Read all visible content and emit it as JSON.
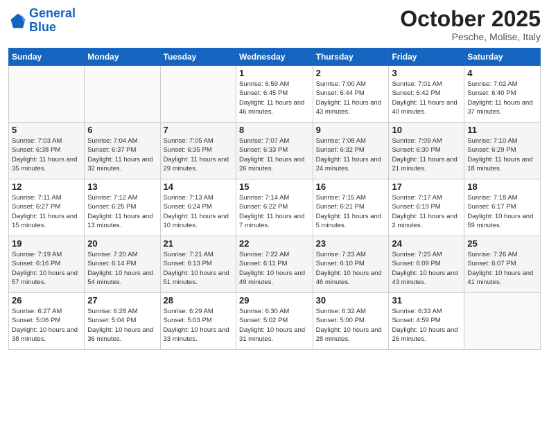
{
  "header": {
    "logo": {
      "line1": "General",
      "line2": "Blue"
    },
    "title": "October 2025",
    "subtitle": "Pesche, Molise, Italy"
  },
  "weekdays": [
    "Sunday",
    "Monday",
    "Tuesday",
    "Wednesday",
    "Thursday",
    "Friday",
    "Saturday"
  ],
  "weeks": [
    [
      {
        "day": "",
        "sunrise": "",
        "sunset": "",
        "daylight": ""
      },
      {
        "day": "",
        "sunrise": "",
        "sunset": "",
        "daylight": ""
      },
      {
        "day": "",
        "sunrise": "",
        "sunset": "",
        "daylight": ""
      },
      {
        "day": "1",
        "sunrise": "Sunrise: 6:59 AM",
        "sunset": "Sunset: 6:45 PM",
        "daylight": "Daylight: 11 hours and 46 minutes."
      },
      {
        "day": "2",
        "sunrise": "Sunrise: 7:00 AM",
        "sunset": "Sunset: 6:44 PM",
        "daylight": "Daylight: 11 hours and 43 minutes."
      },
      {
        "day": "3",
        "sunrise": "Sunrise: 7:01 AM",
        "sunset": "Sunset: 6:42 PM",
        "daylight": "Daylight: 11 hours and 40 minutes."
      },
      {
        "day": "4",
        "sunrise": "Sunrise: 7:02 AM",
        "sunset": "Sunset: 6:40 PM",
        "daylight": "Daylight: 11 hours and 37 minutes."
      }
    ],
    [
      {
        "day": "5",
        "sunrise": "Sunrise: 7:03 AM",
        "sunset": "Sunset: 6:38 PM",
        "daylight": "Daylight: 11 hours and 35 minutes."
      },
      {
        "day": "6",
        "sunrise": "Sunrise: 7:04 AM",
        "sunset": "Sunset: 6:37 PM",
        "daylight": "Daylight: 11 hours and 32 minutes."
      },
      {
        "day": "7",
        "sunrise": "Sunrise: 7:05 AM",
        "sunset": "Sunset: 6:35 PM",
        "daylight": "Daylight: 11 hours and 29 minutes."
      },
      {
        "day": "8",
        "sunrise": "Sunrise: 7:07 AM",
        "sunset": "Sunset: 6:33 PM",
        "daylight": "Daylight: 11 hours and 26 minutes."
      },
      {
        "day": "9",
        "sunrise": "Sunrise: 7:08 AM",
        "sunset": "Sunset: 6:32 PM",
        "daylight": "Daylight: 11 hours and 24 minutes."
      },
      {
        "day": "10",
        "sunrise": "Sunrise: 7:09 AM",
        "sunset": "Sunset: 6:30 PM",
        "daylight": "Daylight: 11 hours and 21 minutes."
      },
      {
        "day": "11",
        "sunrise": "Sunrise: 7:10 AM",
        "sunset": "Sunset: 6:29 PM",
        "daylight": "Daylight: 11 hours and 18 minutes."
      }
    ],
    [
      {
        "day": "12",
        "sunrise": "Sunrise: 7:11 AM",
        "sunset": "Sunset: 6:27 PM",
        "daylight": "Daylight: 11 hours and 15 minutes."
      },
      {
        "day": "13",
        "sunrise": "Sunrise: 7:12 AM",
        "sunset": "Sunset: 6:25 PM",
        "daylight": "Daylight: 11 hours and 13 minutes."
      },
      {
        "day": "14",
        "sunrise": "Sunrise: 7:13 AM",
        "sunset": "Sunset: 6:24 PM",
        "daylight": "Daylight: 11 hours and 10 minutes."
      },
      {
        "day": "15",
        "sunrise": "Sunrise: 7:14 AM",
        "sunset": "Sunset: 6:22 PM",
        "daylight": "Daylight: 11 hours and 7 minutes."
      },
      {
        "day": "16",
        "sunrise": "Sunrise: 7:15 AM",
        "sunset": "Sunset: 6:21 PM",
        "daylight": "Daylight: 11 hours and 5 minutes."
      },
      {
        "day": "17",
        "sunrise": "Sunrise: 7:17 AM",
        "sunset": "Sunset: 6:19 PM",
        "daylight": "Daylight: 11 hours and 2 minutes."
      },
      {
        "day": "18",
        "sunrise": "Sunrise: 7:18 AM",
        "sunset": "Sunset: 6:17 PM",
        "daylight": "Daylight: 10 hours and 59 minutes."
      }
    ],
    [
      {
        "day": "19",
        "sunrise": "Sunrise: 7:19 AM",
        "sunset": "Sunset: 6:16 PM",
        "daylight": "Daylight: 10 hours and 57 minutes."
      },
      {
        "day": "20",
        "sunrise": "Sunrise: 7:20 AM",
        "sunset": "Sunset: 6:14 PM",
        "daylight": "Daylight: 10 hours and 54 minutes."
      },
      {
        "day": "21",
        "sunrise": "Sunrise: 7:21 AM",
        "sunset": "Sunset: 6:13 PM",
        "daylight": "Daylight: 10 hours and 51 minutes."
      },
      {
        "day": "22",
        "sunrise": "Sunrise: 7:22 AM",
        "sunset": "Sunset: 6:11 PM",
        "daylight": "Daylight: 10 hours and 49 minutes."
      },
      {
        "day": "23",
        "sunrise": "Sunrise: 7:23 AM",
        "sunset": "Sunset: 6:10 PM",
        "daylight": "Daylight: 10 hours and 46 minutes."
      },
      {
        "day": "24",
        "sunrise": "Sunrise: 7:25 AM",
        "sunset": "Sunset: 6:09 PM",
        "daylight": "Daylight: 10 hours and 43 minutes."
      },
      {
        "day": "25",
        "sunrise": "Sunrise: 7:26 AM",
        "sunset": "Sunset: 6:07 PM",
        "daylight": "Daylight: 10 hours and 41 minutes."
      }
    ],
    [
      {
        "day": "26",
        "sunrise": "Sunrise: 6:27 AM",
        "sunset": "Sunset: 5:06 PM",
        "daylight": "Daylight: 10 hours and 38 minutes."
      },
      {
        "day": "27",
        "sunrise": "Sunrise: 6:28 AM",
        "sunset": "Sunset: 5:04 PM",
        "daylight": "Daylight: 10 hours and 36 minutes."
      },
      {
        "day": "28",
        "sunrise": "Sunrise: 6:29 AM",
        "sunset": "Sunset: 5:03 PM",
        "daylight": "Daylight: 10 hours and 33 minutes."
      },
      {
        "day": "29",
        "sunrise": "Sunrise: 6:30 AM",
        "sunset": "Sunset: 5:02 PM",
        "daylight": "Daylight: 10 hours and 31 minutes."
      },
      {
        "day": "30",
        "sunrise": "Sunrise: 6:32 AM",
        "sunset": "Sunset: 5:00 PM",
        "daylight": "Daylight: 10 hours and 28 minutes."
      },
      {
        "day": "31",
        "sunrise": "Sunrise: 6:33 AM",
        "sunset": "Sunset: 4:59 PM",
        "daylight": "Daylight: 10 hours and 26 minutes."
      },
      {
        "day": "",
        "sunrise": "",
        "sunset": "",
        "daylight": ""
      }
    ]
  ]
}
